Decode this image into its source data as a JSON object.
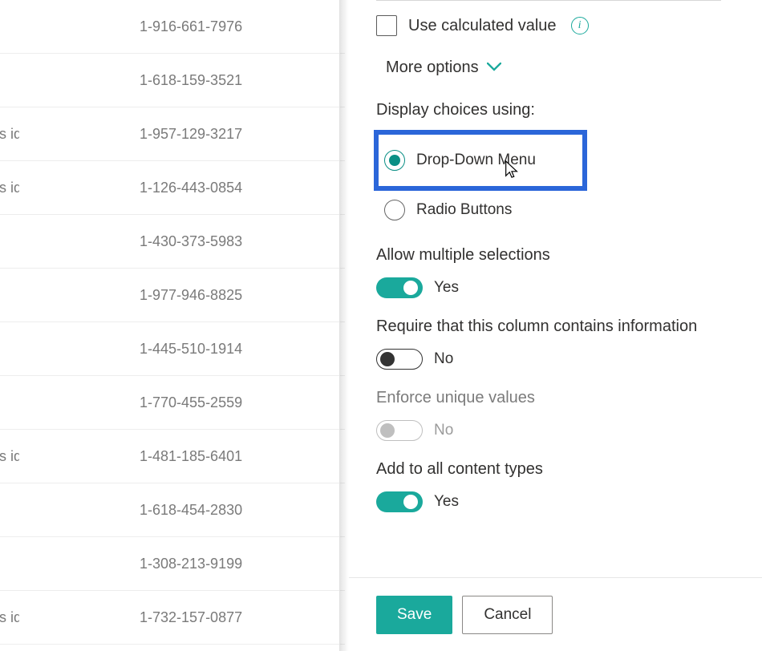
{
  "list": {
    "rows": [
      {
        "left": "",
        "phone": "1-916-661-7976"
      },
      {
        "left": "",
        "phone": "1-618-159-3521"
      },
      {
        "left": "rhoncus ides",
        "phone": "1-957-129-3217"
      },
      {
        "left": "rhoncus ides",
        "phone": "1-126-443-0854"
      },
      {
        "left": "",
        "phone": "1-430-373-5983"
      },
      {
        "left": "",
        "phone": "1-977-946-8825"
      },
      {
        "left": "",
        "phone": "1-445-510-1914"
      },
      {
        "left": "",
        "phone": "1-770-455-2559"
      },
      {
        "left": "rhoncus ides",
        "phone": "1-481-185-6401"
      },
      {
        "left": "",
        "phone": "1-618-454-2830"
      },
      {
        "left": "",
        "phone": "1-308-213-9199"
      },
      {
        "left": "rhoncus ides",
        "phone": "1-732-157-0877"
      }
    ]
  },
  "panel": {
    "calculated": {
      "checked": false,
      "label": "Use calculated value"
    },
    "more_options": "More options",
    "display_choices": {
      "label": "Display choices using:",
      "dropdown": "Drop-Down Menu",
      "radio": "Radio Buttons",
      "selected": "dropdown"
    },
    "allow_multiple": {
      "label": "Allow multiple selections",
      "on": true,
      "value": "Yes"
    },
    "require": {
      "label": "Require that this column contains information",
      "on": false,
      "value": "No"
    },
    "unique": {
      "label": "Enforce unique values",
      "enabled": false,
      "on": false,
      "value": "No"
    },
    "content_types": {
      "label": "Add to all content types",
      "on": true,
      "value": "Yes"
    },
    "save": "Save",
    "cancel": "Cancel"
  }
}
